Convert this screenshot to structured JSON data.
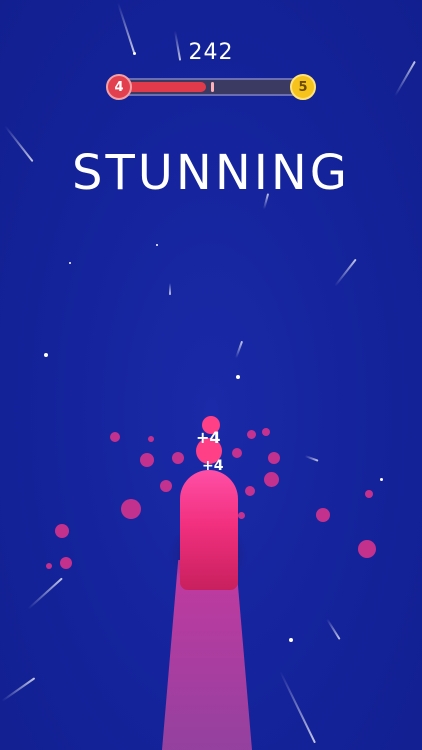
{
  "hud": {
    "score": "242",
    "current_level": "4",
    "next_level": "5",
    "level_progress": 0.47
  },
  "banner": {
    "text": "STUNNING"
  },
  "hits": [
    {
      "text": "+4"
    },
    {
      "text": "+4"
    }
  ],
  "colors": {
    "background": "#14239a",
    "progress_fill": "#e13a4b",
    "current_level_badge": "#e2404f",
    "next_level_badge": "#f6c21c",
    "player": "#ff3f86",
    "trail": "#d63ca0"
  }
}
